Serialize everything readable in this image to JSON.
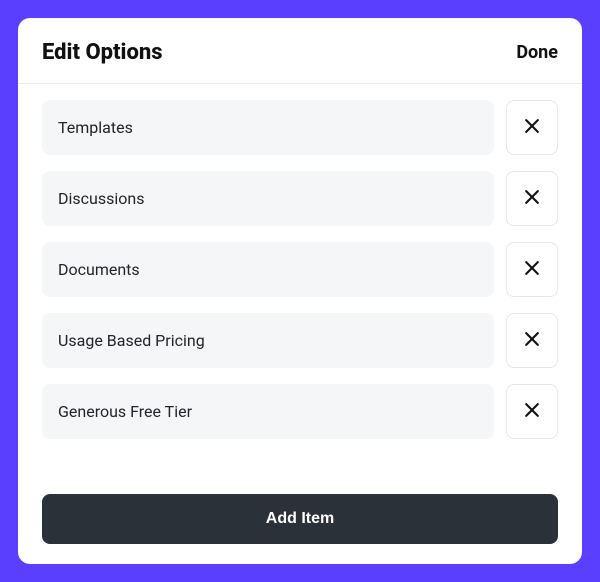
{
  "header": {
    "title": "Edit Options",
    "done_label": "Done"
  },
  "items": [
    {
      "label": "Templates"
    },
    {
      "label": "Discussions"
    },
    {
      "label": "Documents"
    },
    {
      "label": "Usage Based Pricing"
    },
    {
      "label": "Generous Free Tier"
    }
  ],
  "footer": {
    "add_label": "Add Item"
  }
}
